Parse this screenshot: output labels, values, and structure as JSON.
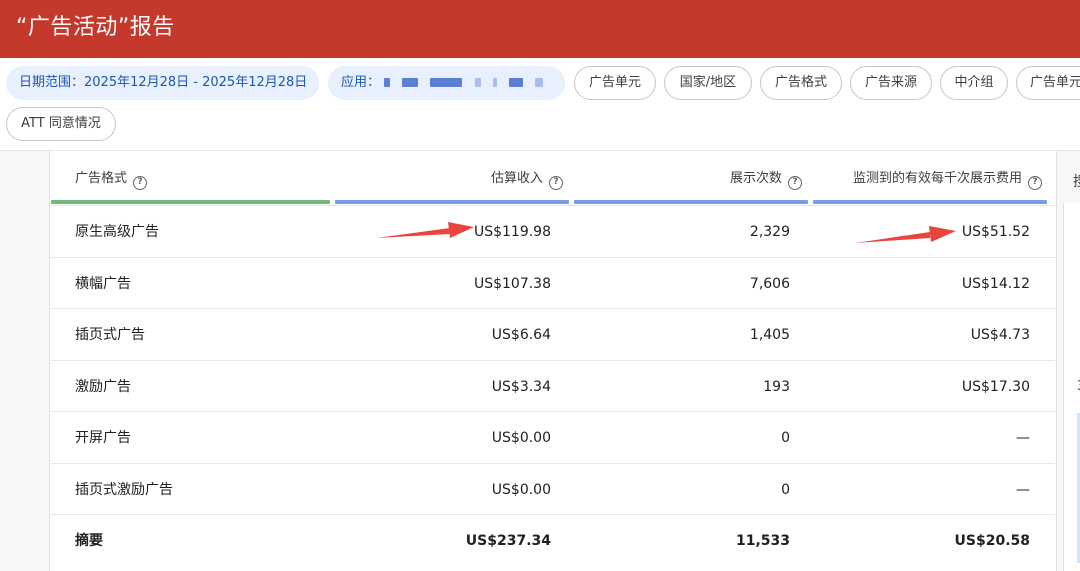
{
  "title": "“广告活动”报告",
  "filters": {
    "date_range": "日期范围：2025年12月28日 - 2025年12月28日",
    "app_label": "应用：",
    "chips": [
      "广告单元",
      "国家/地区",
      "广告格式",
      "广告来源",
      "中介组",
      "广告单元",
      "ATT 同意情况"
    ]
  },
  "right_panel": {
    "header_fragment": "搜",
    "side_fragment": "3"
  },
  "table": {
    "columns": [
      "广告格式",
      "估算收入",
      "展示次数",
      "监测到的有效每千次展示费用"
    ],
    "column_bar_colors": [
      "#72b77b",
      "#7b9de8",
      "#7b9de8",
      "#7b9de8"
    ],
    "rows": [
      {
        "format": "原生高级广告",
        "revenue": "US$119.98",
        "impressions": "2,329",
        "ecpm": "US$51.52"
      },
      {
        "format": "横幅广告",
        "revenue": "US$107.38",
        "impressions": "7,606",
        "ecpm": "US$14.12"
      },
      {
        "format": "插页式广告",
        "revenue": "US$6.64",
        "impressions": "1,405",
        "ecpm": "US$4.73"
      },
      {
        "format": "激励广告",
        "revenue": "US$3.34",
        "impressions": "193",
        "ecpm": "US$17.30"
      },
      {
        "format": "开屏广告",
        "revenue": "US$0.00",
        "impressions": "0",
        "ecpm": "—"
      },
      {
        "format": "插页式激励广告",
        "revenue": "US$0.00",
        "impressions": "0",
        "ecpm": "—"
      }
    ],
    "summary": {
      "format": "摘要",
      "revenue": "US$237.34",
      "impressions": "11,533",
      "ecpm": "US$20.58"
    }
  },
  "annotation_color": "#e8453c"
}
